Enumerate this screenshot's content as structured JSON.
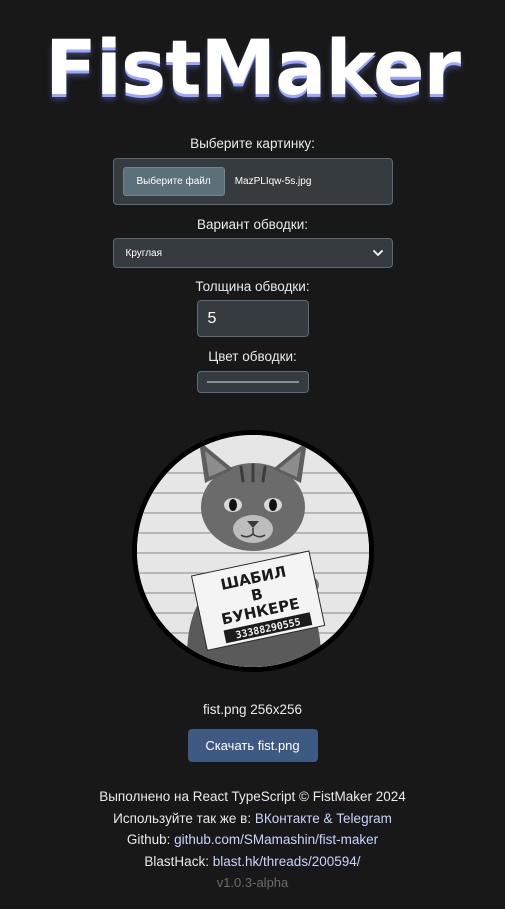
{
  "app": {
    "title": "FistMaker"
  },
  "form": {
    "picture_label": "Выберите картинку:",
    "file_button_label": "Выберите файл",
    "file_name": "MazPLIqw-5s.jpg",
    "variant_label": "Вариант обводки:",
    "variant_value": "Круглая",
    "thickness_label": "Толщина обводки:",
    "thickness_value": "5",
    "color_label": "Цвет обводки:"
  },
  "preview": {
    "sign_line1": "ШАБИЛ",
    "sign_line2": "В",
    "sign_line3": "БУНКЕРЕ",
    "sign_number": "33388290555"
  },
  "output": {
    "file_info": "fist.png 256x256",
    "download_label": "Скачать fist.png"
  },
  "footer": {
    "made_with": "Выполнено на React TypeScript © FistMaker 2024",
    "also_use_prefix": "Используйте так же в: ",
    "also_use_links": "ВКонтакте & Telegram",
    "github_prefix": "Github: ",
    "github_link": "github.com/SMamashin/fist-maker",
    "blasthack_prefix": "BlastHack: ",
    "blasthack_link": "blast.hk/threads/200594/",
    "version": "v1.0.3-alpha"
  }
}
